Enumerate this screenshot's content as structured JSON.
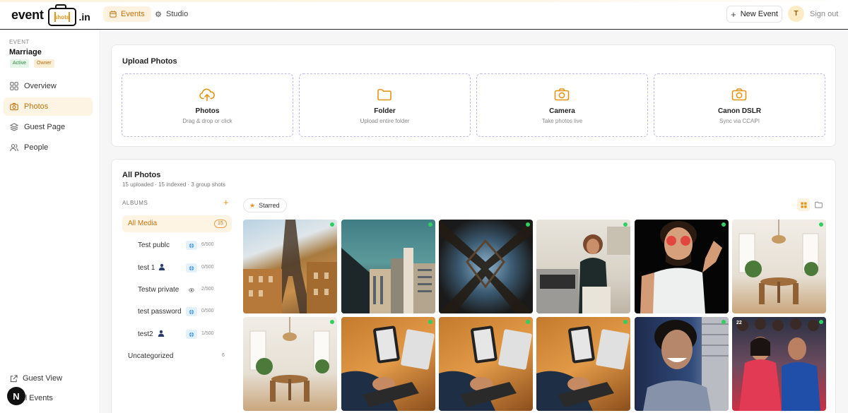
{
  "brand": {
    "word1": "event",
    "lens_text": "shots",
    "word2": ".in"
  },
  "topnav": {
    "tabs": [
      {
        "label": "Events",
        "active": true
      },
      {
        "label": "Studio",
        "active": false
      }
    ],
    "new_event_label": "New Event",
    "avatar_initial": "T",
    "signout_label": "Sign out"
  },
  "sidebar": {
    "event_label": "EVENT",
    "event_name": "Marriage",
    "badges": [
      "Active",
      "Owner"
    ],
    "items": [
      {
        "label": "Overview",
        "icon": "grid-icon",
        "active": false
      },
      {
        "label": "Photos",
        "icon": "camera-icon",
        "active": true
      },
      {
        "label": "Guest Page",
        "icon": "layers-icon",
        "active": false
      },
      {
        "label": "People",
        "icon": "users-icon",
        "active": false
      }
    ],
    "guest_view_label": "Guest View",
    "all_events_label": "All Events",
    "n_badge": "N"
  },
  "upload": {
    "title": "Upload Photos",
    "options": [
      {
        "title": "Photos",
        "subtitle": "Drag & drop or click",
        "icon": "cloud-upload-icon"
      },
      {
        "title": "Folder",
        "subtitle": "Upload entire folder",
        "icon": "folder-icon"
      },
      {
        "title": "Camera",
        "subtitle": "Take photos live",
        "icon": "camera-icon"
      },
      {
        "title": "Canon DSLR",
        "subtitle": "Sync via CCAPI",
        "icon": "camera-icon"
      }
    ]
  },
  "photos": {
    "title": "All Photos",
    "subtitle": "15 uploaded · 15 indexed · 3 group shots",
    "albums_heading": "ALBUMS",
    "albums_add": "+",
    "starred_label": "Starred",
    "all_media": {
      "label": "All Media",
      "count": "15"
    },
    "albums": [
      {
        "name": "Test publc",
        "icon": "globe-icon",
        "count": "6/500",
        "person": false
      },
      {
        "name": "test 1",
        "icon": "globe-icon",
        "count": "0/500",
        "person": true
      },
      {
        "name": "Testw private",
        "icon": "eye-icon",
        "count": "2/500",
        "person": false
      },
      {
        "name": "test password",
        "icon": "globe-icon",
        "count": "0/500",
        "person": false
      },
      {
        "name": "test2",
        "icon": "globe-icon",
        "count": "1/500",
        "person": true
      }
    ],
    "uncategorized": {
      "label": "Uncategorized",
      "count": "6"
    },
    "thumbnails": [
      {
        "subject": "eiffel-tower-street",
        "tag": ""
      },
      {
        "subject": "city-buildings-teal-sky",
        "tag": ""
      },
      {
        "subject": "eiffel-tower-from-below",
        "tag": ""
      },
      {
        "subject": "woman-in-kitchen",
        "tag": ""
      },
      {
        "subject": "man-with-sunglasses",
        "tag": ""
      },
      {
        "subject": "dining-room-interior",
        "tag": ""
      },
      {
        "subject": "dining-room-interior",
        "tag": ""
      },
      {
        "subject": "hand-holding-tablet",
        "tag": ""
      },
      {
        "subject": "hand-holding-tablet",
        "tag": ""
      },
      {
        "subject": "hand-holding-tablet",
        "tag": ""
      },
      {
        "subject": "smiling-man-portrait",
        "tag": ""
      },
      {
        "subject": "group-wedding-photo",
        "tag": "22"
      }
    ]
  },
  "colors": {
    "accent": "#e59416",
    "accent_bg": "#fdf2df",
    "dashed_border": "#c2b7e6",
    "online_dot": "#2fd061"
  }
}
